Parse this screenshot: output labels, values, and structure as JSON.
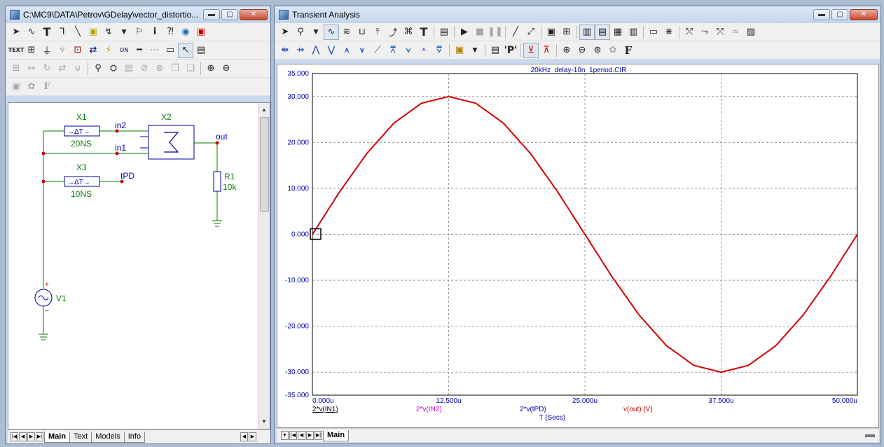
{
  "colors": {
    "curve": "#d40000",
    "grid": "#7f7f7f",
    "axis_text": "#0000b0",
    "wire": "#008000",
    "node": "#d40000",
    "label_green": "#0a7d0a",
    "label_blue": "#0000c8"
  },
  "left_window": {
    "title": "C:\\MC9\\DATA\\Petrov\\GDelay\\vector_distortio...",
    "buttons": [
      "minimize",
      "maximize",
      "close"
    ],
    "toolbar1": [
      "select-arrow-icon",
      "wire-icon",
      "text-tool-icon",
      "orthogonal-wire-icon",
      "diagonal-line-icon",
      "component-icon",
      "gate-icon",
      "flag-icon",
      "info-icon",
      "help-icon",
      "globe-icon",
      "node-icon"
    ],
    "toolbar2": [
      "text-label-icon",
      "pin-icon",
      "ground-icon",
      "bus-icon",
      "branch-icon",
      "probe-icon",
      "toggle-icon",
      "line-icon",
      "grid-icon",
      "page-icon",
      "select-icon",
      "properties-icon"
    ],
    "toolbar3": [
      "align-icon",
      "flip-h-icon",
      "rotate-icon",
      "mirror-icon",
      "step-icon",
      "find-icon",
      "binoculars-icon",
      "list-icon",
      "stop-icon",
      "cancel-icon",
      "copy-icon",
      "paste-icon",
      "zoom-in-icon",
      "zoom-out-icon"
    ],
    "toolbar4": [
      "camera-icon",
      "palette-icon",
      "font-icon"
    ],
    "schematic": {
      "X1": "X1",
      "X1_val": "20NS",
      "X2": "X2",
      "X3": "X3",
      "X3_val": "10NS",
      "in1": "in1",
      "in2": "in2",
      "out": "out",
      "tPD": "tPD",
      "R1": "R1",
      "R1_val": "10k",
      "V1": "V1",
      "delay_symbol": "→ΔT→",
      "plus": "+",
      "minus": "−"
    },
    "tabs": [
      {
        "label": "Main",
        "active": true
      },
      {
        "label": "Text",
        "active": false
      },
      {
        "label": "Models",
        "active": false
      },
      {
        "label": "Info",
        "active": false
      }
    ]
  },
  "right_window": {
    "title": "Transient Analysis",
    "toolbar1": [
      "select-arrow-icon",
      "scale-icon",
      "dropdown-icon",
      "waveform-icon",
      "peaks-icon",
      "slope-icon",
      "min-max-icon",
      "measure-icon",
      "cursor-icon",
      "text-tool-icon",
      "properties-icon",
      "run-icon",
      "stop-icon",
      "pause-icon",
      "line-icon",
      "diagonal-line-icon",
      "frame-icon",
      "grid-icon",
      "vgrid-icon",
      "hgrid-icon",
      "minor-grid-icon",
      "tick-icon",
      "ruler-icon",
      "token-icon",
      "data-point-icon",
      "thinning-icon",
      "analysis-icon"
    ],
    "toolbar2": [
      "left-cursor-icon",
      "right-cursor-icon",
      "peak-icon",
      "valley-icon",
      "high-icon",
      "low-icon",
      "inflection-icon",
      "global-high-icon",
      "global-low-icon",
      "top-icon",
      "bottom-icon",
      "properties-icon",
      "list-icon",
      "P-icon",
      "flip-x-icon",
      "flip-y-icon",
      "zoom-in-icon",
      "zoom-out-icon",
      "zoom-fit-icon",
      "palette-icon",
      "font-icon"
    ],
    "tabs": [
      {
        "label": "Main",
        "active": true
      }
    ]
  },
  "chart_data": {
    "type": "line",
    "title": "20kHz_delay-10n_1period.CIR",
    "xlabel": "T (Secs)",
    "x_ticks": [
      "0.000u",
      "12.500u",
      "25.000u",
      "37.500u",
      "50.000u"
    ],
    "y_ticks": [
      "35.000",
      "30.000",
      "20.000",
      "10.000",
      "0.000",
      "-10.000",
      "-20.000",
      "-30.000",
      "-35.000"
    ],
    "xlim": [
      0,
      50
    ],
    "ylim": [
      -35,
      35
    ],
    "x_unit": "us",
    "series": [
      {
        "name": "v(out) (V)",
        "color": "#d40000",
        "x": [
          0,
          2.5,
          5,
          7.5,
          10,
          12.5,
          15,
          17.5,
          20,
          22.5,
          25,
          27.5,
          30,
          32.5,
          35,
          37.5,
          40,
          42.5,
          45,
          47.5,
          50
        ],
        "y": [
          0,
          9.27,
          17.63,
          24.27,
          28.53,
          30,
          28.53,
          24.27,
          17.63,
          9.27,
          0,
          -9.27,
          -17.63,
          -24.27,
          -28.53,
          -30,
          -28.53,
          -24.27,
          -17.63,
          -9.27,
          0
        ]
      }
    ],
    "legend": [
      {
        "label": "2*v(IN1)",
        "color": "#000000"
      },
      {
        "label": "2*v(IN2)",
        "color": "#e000e0"
      },
      {
        "label": "2*v(tPD)",
        "color": "#0000c8"
      },
      {
        "label": "v(out) (V)",
        "color": "#d40000"
      }
    ],
    "grid": true
  }
}
